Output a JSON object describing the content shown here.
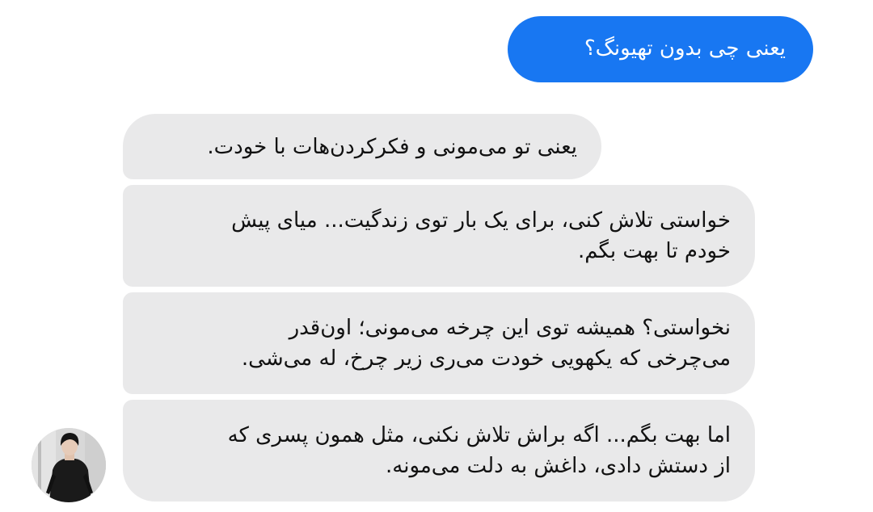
{
  "conversation": {
    "sent": [
      {
        "text": "یعنی چی بدون تهیونگ؟"
      }
    ],
    "received": [
      {
        "text": "یعنی تو می‌مونی و فکرکردن‌هات با خودت."
      },
      {
        "text": "خواستی تلاش کنی، برای یک بار توی زندگیت... میای پیش\nخودم تا بهت بگم."
      },
      {
        "text": "نخواستی؟ همیشه توی این چرخه می‌مونی؛ اون‌قدر\nمی‌چرخی که یکهویی خودت می‌ری زیر چرخ، له می‌شی."
      },
      {
        "text": "اما بهت بگم... اگه براش تلاش نکنی، مثل همون پسری که\nاز دستش دادی، داغش به دلت می‌مونه."
      }
    ]
  },
  "colors": {
    "sent_bubble": "#1877f2",
    "received_bubble": "#e9e9ea",
    "background": "#ffffff"
  },
  "icons": {
    "avatar": "contact-avatar-photo"
  }
}
